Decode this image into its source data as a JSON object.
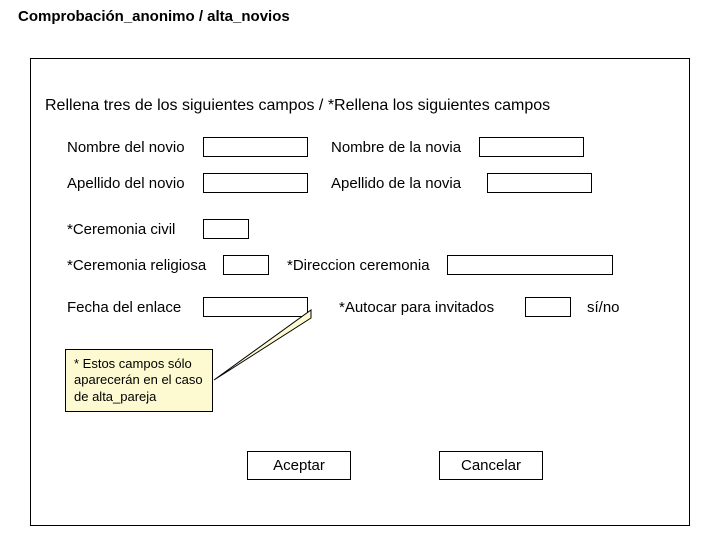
{
  "breadcrumb": "Comprobación_anonimo /  alta_novios",
  "heading": "Rellena tres de los siguientes campos / *Rellena los siguientes campos",
  "labels": {
    "nombre_novio": "Nombre del novio",
    "nombre_novia": "Nombre de la novia",
    "apellido_novio": "Apellido del novio",
    "apellido_novia": "Apellido de la novia",
    "ceremonia_civil": "*Ceremonia civil",
    "ceremonia_religiosa": "*Ceremonia religiosa",
    "direccion_ceremonia": "*Direccion ceremonia",
    "fecha_enlace": "Fecha del enlace",
    "autocar_invitados": "*Autocar para invitados",
    "si_no": "sí/no"
  },
  "note": "* Estos campos sólo aparecerán en el caso de alta_pareja",
  "buttons": {
    "accept": "Aceptar",
    "cancel": "Cancelar"
  }
}
